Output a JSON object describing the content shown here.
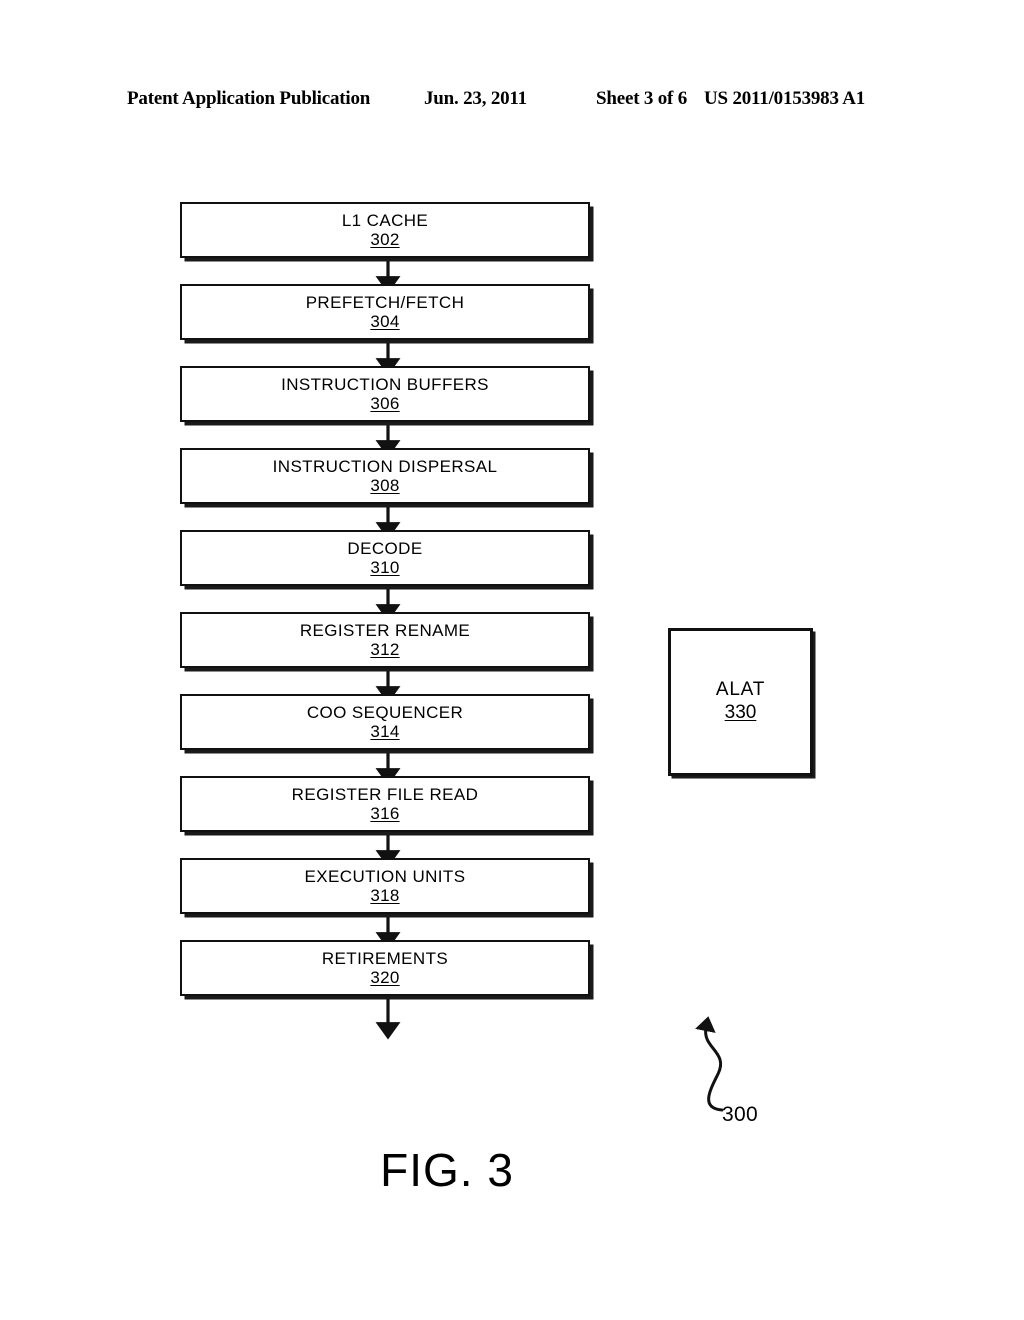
{
  "header": {
    "publication": "Patent Application Publication",
    "date": "Jun. 23, 2011",
    "sheet": "Sheet 3 of 6",
    "patent_number": "US 2011/0153983 A1"
  },
  "figure": {
    "caption": "FIG. 3",
    "system_reference": "300"
  },
  "diagram": {
    "type": "flowchart",
    "orientation": "vertical",
    "pipeline": [
      {
        "label": "L1 CACHE",
        "ref": "302"
      },
      {
        "label": "PREFETCH/FETCH",
        "ref": "304"
      },
      {
        "label": "INSTRUCTION BUFFERS",
        "ref": "306"
      },
      {
        "label": "INSTRUCTION DISPERSAL",
        "ref": "308"
      },
      {
        "label": "DECODE",
        "ref": "310"
      },
      {
        "label": "REGISTER RENAME",
        "ref": "312"
      },
      {
        "label": "COO SEQUENCER",
        "ref": "314"
      },
      {
        "label": "REGISTER FILE READ",
        "ref": "316"
      },
      {
        "label": "EXECUTION UNITS",
        "ref": "318"
      },
      {
        "label": "RETIREMENTS",
        "ref": "320"
      }
    ],
    "standalone": [
      {
        "label": "ALAT",
        "ref": "330"
      }
    ]
  }
}
